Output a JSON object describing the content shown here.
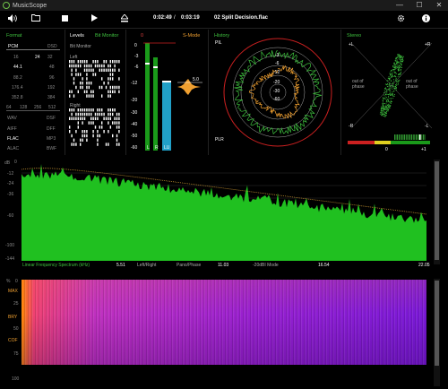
{
  "app": {
    "title": "MusicScope"
  },
  "window": {
    "minimize": "—",
    "maximize": "☐",
    "close": "✕"
  },
  "toolbar": {
    "elapsed": "0:02:49",
    "divider": "/",
    "total": "0:03:19",
    "filename": "02 Split Decision.flac"
  },
  "format": {
    "title": "Format",
    "pcm": "PCM",
    "dsd": "DSD",
    "bits": [
      "16",
      "24",
      "32"
    ],
    "rates_left": [
      "44.1",
      "88.2",
      "176.4",
      "352.8"
    ],
    "rates_right": [
      "48",
      "96",
      "192",
      "384"
    ],
    "dsd_rates": [
      "64",
      "128",
      "256",
      "512"
    ],
    "containers": [
      [
        "WAV",
        "DSF"
      ],
      [
        "AIFF",
        "DFF"
      ],
      [
        "FLAC",
        "MP3"
      ],
      [
        "ALAC",
        "BWF"
      ]
    ]
  },
  "levels": {
    "title": "Levels",
    "bit_monitor": "Bit Monitor",
    "left": "Left",
    "right": "Right"
  },
  "meter": {
    "ticks": [
      "0",
      "-3",
      "-6",
      "-12",
      "-20",
      "-30",
      "-40",
      "-50",
      "-60"
    ],
    "top_label": "0",
    "smode": "S-Mode",
    "peak_value": "5.0",
    "l": "L",
    "r": "R",
    "lu": "LU"
  },
  "history": {
    "title": "History",
    "pil": "PIL",
    "plr": "PLR",
    "ring_labels": [
      "-3",
      "-6",
      "-12",
      "-20",
      "-30",
      "-60"
    ]
  },
  "stereo": {
    "title": "Stereo",
    "plus_l": "+L",
    "plus_r": "+R",
    "minus_l": "-L",
    "minus_r": "-R",
    "out_left": "out of phase",
    "out_right": "out of phase",
    "corr_0": "0",
    "corr_1": "+1"
  },
  "spectrum": {
    "db_label": "dB",
    "y_ticks": [
      "0",
      "-12",
      "-24",
      "-36",
      "-60",
      "-100",
      "-144"
    ],
    "caption": "Linear Frequency Spectrum (kHz)",
    "x_ticks": [
      "5.51",
      "11.03",
      "16.54",
      "22.05"
    ],
    "modes": [
      "Left/Right",
      "Pano/Phase",
      "-20dBI Mode"
    ]
  },
  "spectrogram": {
    "pct_label": "%",
    "y_ticks": [
      "0",
      "25",
      "50",
      "75",
      "100"
    ],
    "left_labels": [
      "MAX",
      "BRY",
      "COF"
    ]
  },
  "colors": {
    "green": "#3ec03e",
    "orange": "#f0a030",
    "bar": "#21a0c8",
    "red": "#cc2020",
    "magenta": "#c020c0"
  },
  "icons": [
    "volume-icon",
    "folder-icon",
    "stop-icon",
    "play-icon",
    "eject-icon",
    "gear-icon",
    "info-icon"
  ]
}
